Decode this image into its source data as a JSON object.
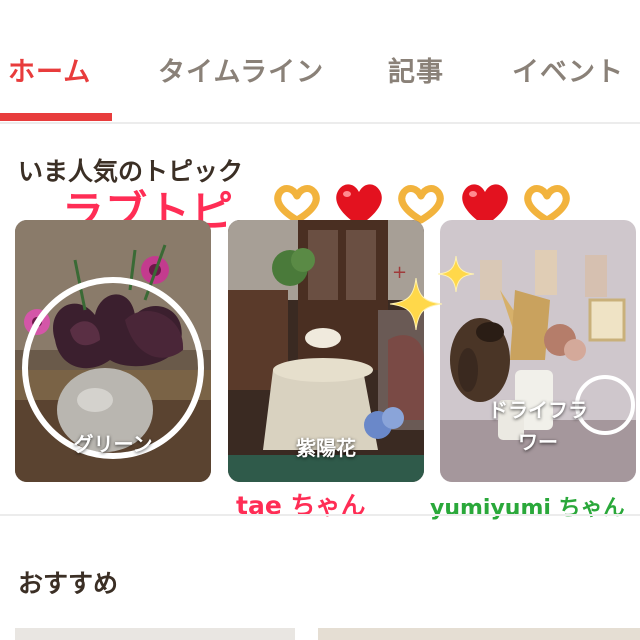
{
  "tabs": [
    {
      "label": "ホーム",
      "active": true
    },
    {
      "label": "タイムライン",
      "active": false
    },
    {
      "label": "記事",
      "active": false
    },
    {
      "label": "イベント",
      "active": false
    }
  ],
  "popular": {
    "title": "いま人気のトピック",
    "overlay_title": "ラブトピ",
    "emoji": [
      "heart-hands-icon",
      "red-heart-icon",
      "heart-hands-icon",
      "red-heart-icon",
      "heart-hands-icon"
    ],
    "cards": [
      {
        "label": "グリーン"
      },
      {
        "label": "紫陽花"
      },
      {
        "label": "ドライフラ\nワー"
      }
    ],
    "credits": [
      {
        "text": "tae ちゃん",
        "color": "#ff2d55"
      },
      {
        "text": "yumiyumi ちゃん",
        "color": "#2aa83a"
      }
    ]
  },
  "recommended": {
    "title": "おすすめ"
  },
  "colors": {
    "accent": "#e83c3c",
    "overlay_pink": "#ff2d55",
    "overlay_green": "#2aa83a"
  }
}
